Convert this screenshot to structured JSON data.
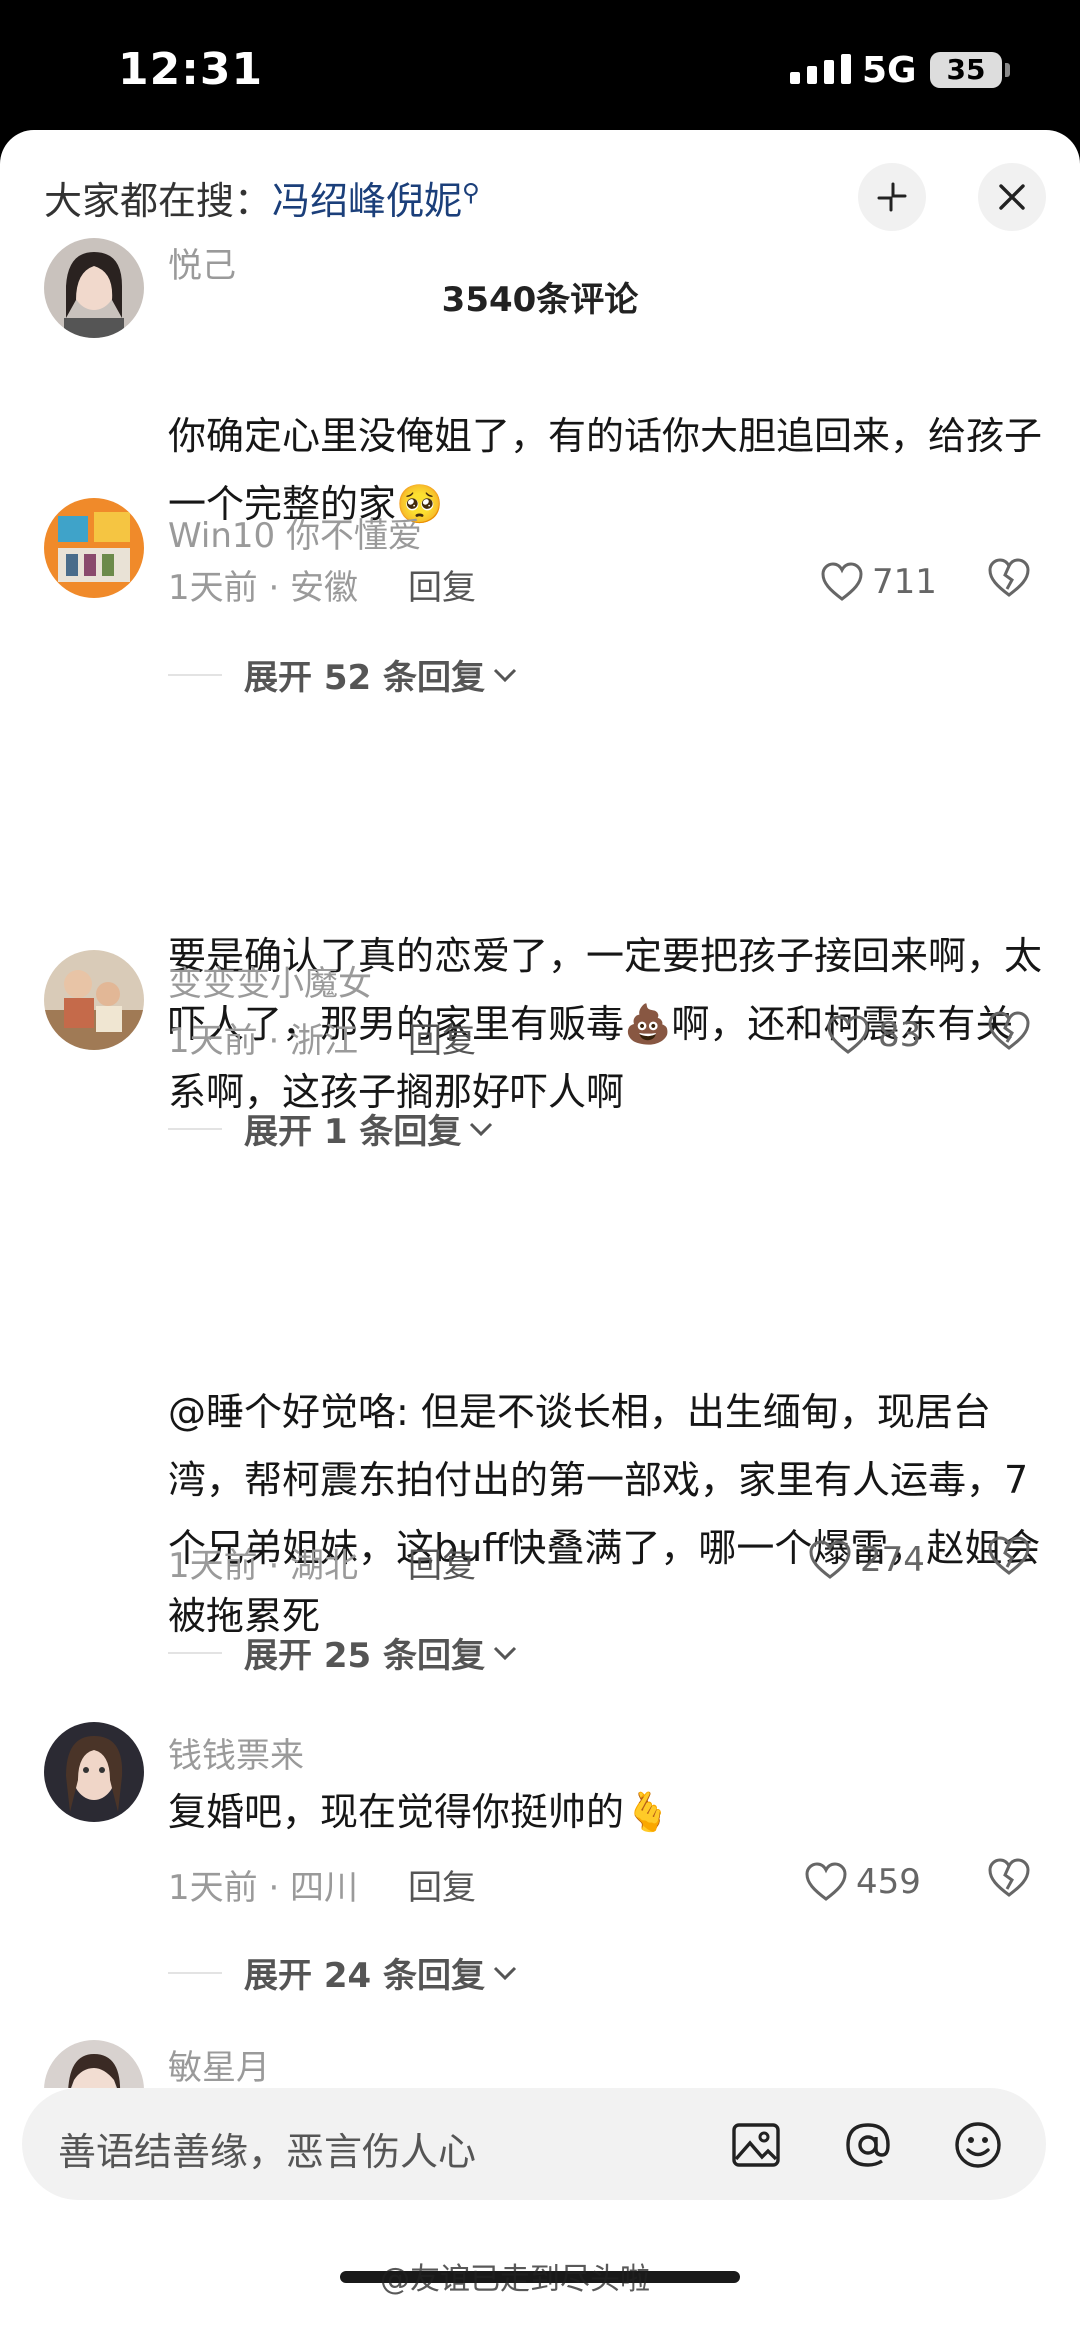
{
  "status_bar": {
    "time": "12:31",
    "network": "5G",
    "battery": "35"
  },
  "header": {
    "search_prefix": "大家都在搜：",
    "search_keyword": "冯绍峰倪妮",
    "comment_count": "3540条评论"
  },
  "comments": [
    {
      "username": "悦己",
      "text": "你确定心里没俺姐了，有的话你大胆追回来，给孩子一个完整的家🥺",
      "meta": "1天前 · 安徽",
      "reply_label": "回复",
      "likes": "711",
      "expand_label": "展开 52 条回复"
    },
    {
      "username": "Win10 你不懂爱",
      "text": "要是确认了真的恋爱了，一定要把孩子接回来啊，太吓人了，那男的家里有贩毒💩啊，还和柯震东有关系啊，这孩子搁那好吓人啊",
      "meta": "1天前 · 浙江",
      "reply_label": "回复",
      "likes": "83",
      "expand_label": "展开 1 条回复"
    },
    {
      "username": "变变变小魔女",
      "text": "@睡个好觉咯: 但是不谈长相，出生缅甸，现居台湾，帮柯震东拍付出的第一部戏，家里有人运毒，7个兄弟姐妹，这buff快叠满了，哪一个爆雷，赵姐会被拖累死",
      "meta": "1天前 · 湖北",
      "reply_label": "回复",
      "likes": "274",
      "expand_label": "展开 25 条回复"
    },
    {
      "username": "钱钱票来",
      "text": "复婚吧，现在觉得你挺帅的🫰",
      "meta": "1天前 · 四川",
      "reply_label": "回复",
      "likes": "459",
      "expand_label": "展开 24 条回复"
    },
    {
      "username": "敏星月"
    }
  ],
  "input": {
    "placeholder": "善语结善缘，恶言伤人心"
  },
  "watermark": "@友谊已走到尽头啦",
  "icons": {
    "search": "search-icon",
    "shrink": "shrink-icon",
    "close": "close-icon",
    "like": "heart-icon",
    "dislike": "broken-heart-icon",
    "image": "image-icon",
    "mention": "at-icon",
    "emoji": "emoji-icon"
  }
}
